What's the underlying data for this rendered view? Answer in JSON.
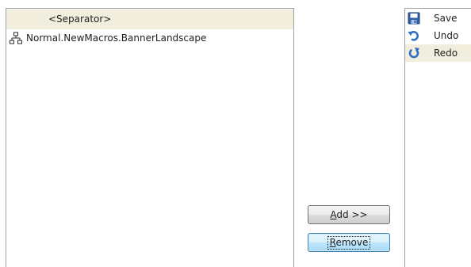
{
  "commands_list": {
    "items": [
      {
        "label": "<Separator>",
        "icon": "none",
        "selected": true
      },
      {
        "label": "Normal.NewMacros.BannerLandscape",
        "icon": "macro-icon",
        "selected": false
      }
    ]
  },
  "buttons": {
    "add_prefix": "",
    "add_mnemonic": "A",
    "add_rest": "dd >>",
    "remove_mnemonic": "R",
    "remove_rest": "emove"
  },
  "toolbar_list": {
    "items": [
      {
        "label": "Save",
        "icon": "save-icon",
        "selected": false
      },
      {
        "label": "Undo",
        "icon": "undo-icon",
        "selected": false
      },
      {
        "label": "Redo",
        "icon": "redo-icon",
        "selected": true
      }
    ]
  },
  "colors": {
    "selection": "#f1eedd",
    "border": "#a0a0a0",
    "focus_border": "#3c7fb1"
  }
}
